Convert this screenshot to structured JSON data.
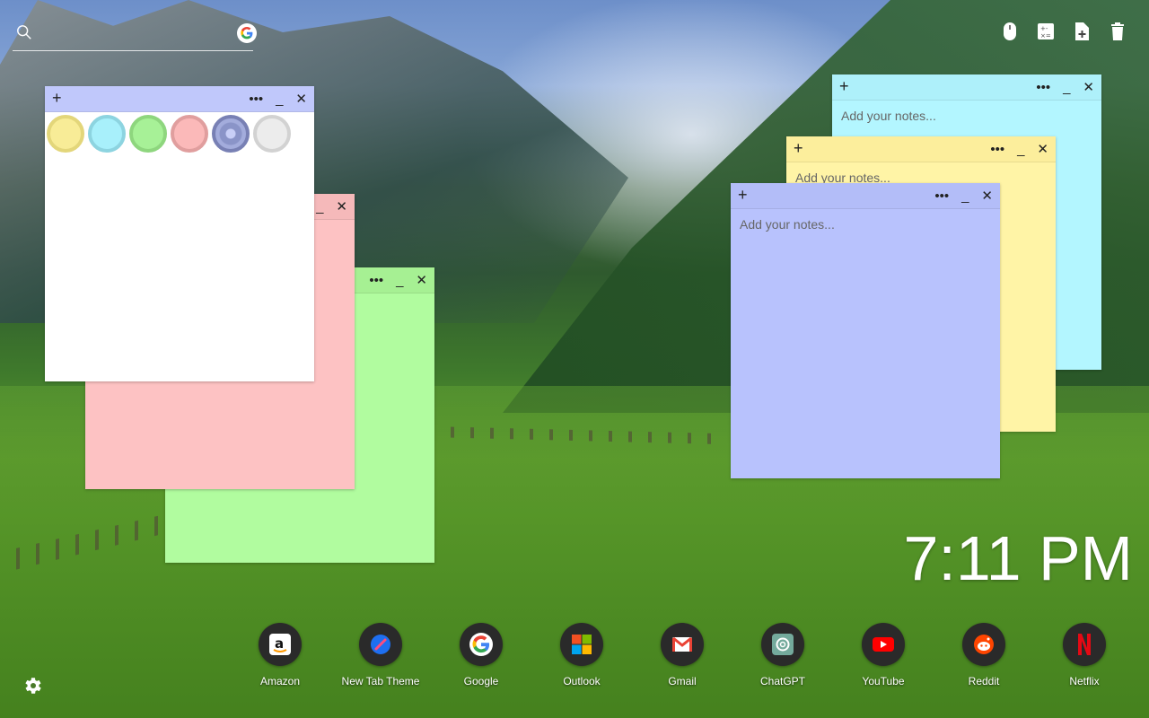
{
  "search": {
    "placeholder": ""
  },
  "top_tools": [
    {
      "name": "mouse-icon"
    },
    {
      "name": "calculator-icon"
    },
    {
      "name": "add-note-icon"
    },
    {
      "name": "trash-icon"
    }
  ],
  "notes": {
    "placeholder": "Add your notes...",
    "plus_label": "+",
    "more_label": "•••",
    "min_label": "_",
    "close_label": "✕"
  },
  "palette": {
    "colors": [
      "#f8ec97",
      "#a8f0fb",
      "#a7f197",
      "#fbb9b9",
      "#8a94c8",
      "#ececec"
    ]
  },
  "clock": {
    "time": "7:11 PM"
  },
  "dock": [
    {
      "label": "Amazon",
      "icon": "amazon-icon"
    },
    {
      "label": "New Tab Theme",
      "icon": "new-tab-theme-icon"
    },
    {
      "label": "Google",
      "icon": "google-icon"
    },
    {
      "label": "Outlook",
      "icon": "outlook-icon"
    },
    {
      "label": "Gmail",
      "icon": "gmail-icon"
    },
    {
      "label": "ChatGPT",
      "icon": "chatgpt-icon"
    },
    {
      "label": "YouTube",
      "icon": "youtube-icon"
    },
    {
      "label": "Reddit",
      "icon": "reddit-icon"
    },
    {
      "label": "Netflix",
      "icon": "netflix-icon"
    }
  ]
}
